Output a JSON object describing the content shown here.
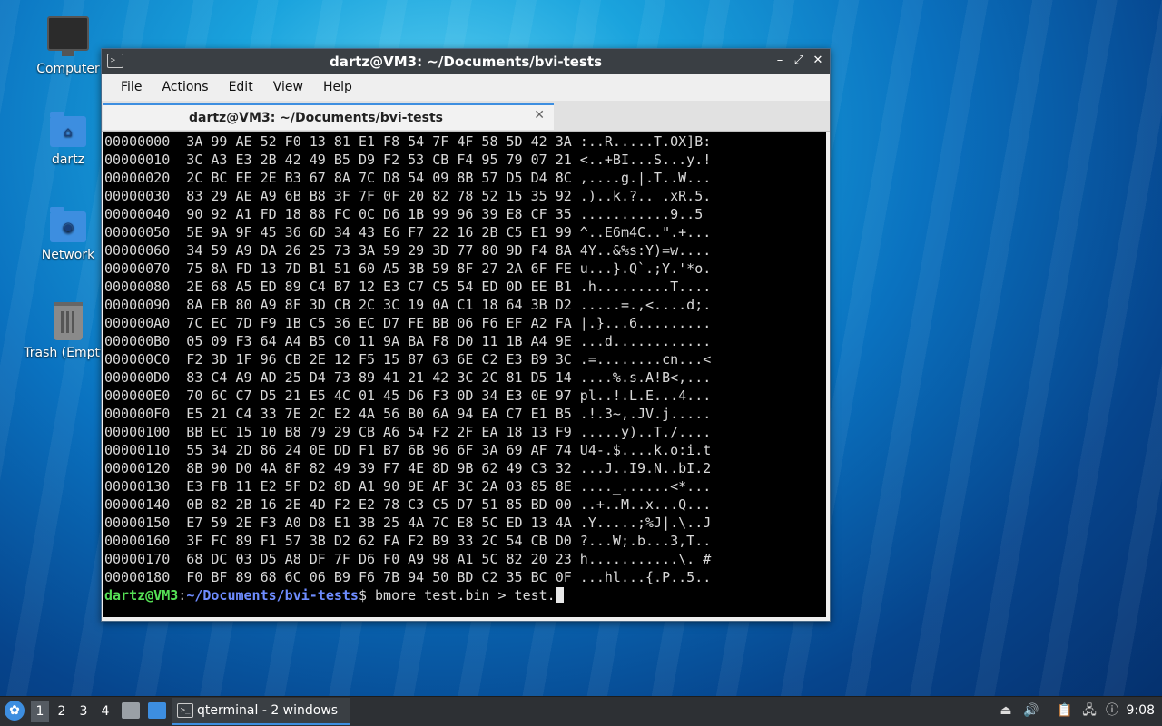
{
  "desktop": {
    "icons": [
      {
        "label": "Computer",
        "icon": "computer-icon"
      },
      {
        "label": "dartz",
        "icon": "home-folder-icon"
      },
      {
        "label": "Network",
        "icon": "network-folder-icon"
      },
      {
        "label": "Trash (Empty)",
        "icon": "trash-icon"
      }
    ]
  },
  "window": {
    "title": "dartz@VM3: ~/Documents/bvi-tests",
    "controls": {
      "minimize": "–",
      "maximize": "⤢",
      "close": "✕"
    },
    "menu": [
      "File",
      "Actions",
      "Edit",
      "View",
      "Help"
    ],
    "tab": {
      "label": "dartz@VM3: ~/Documents/bvi-tests",
      "close": "✕"
    },
    "terminal": {
      "lines": [
        "00000000  3A 99 AE 52 F0 13 81 E1 F8 54 7F 4F 58 5D 42 3A :..R.....T.OX]B:",
        "00000010  3C A3 E3 2B 42 49 B5 D9 F2 53 CB F4 95 79 07 21 <..+BI...S...y.!",
        "00000020  2C BC EE 2E B3 67 8A 7C D8 54 09 8B 57 D5 D4 8C ,....g.|.T..W...",
        "00000030  83 29 AE A9 6B B8 3F 7F 0F 20 82 78 52 15 35 92 .)..k.?.. .xR.5.",
        "00000040  90 92 A1 FD 18 88 FC 0C D6 1B 99 96 39 E8 CF 35 ...........9..5",
        "00000050  5E 9A 9F 45 36 6D 34 43 E6 F7 22 16 2B C5 E1 99 ^..E6m4C..\".+...",
        "00000060  34 59 A9 DA 26 25 73 3A 59 29 3D 77 80 9D F4 8A 4Y..&%s:Y)=w....",
        "00000070  75 8A FD 13 7D B1 51 60 A5 3B 59 8F 27 2A 6F FE u...}.Q`.;Y.'*o.",
        "00000080  2E 68 A5 ED 89 C4 B7 12 E3 C7 C5 54 ED 0D EE B1 .h.........T....",
        "00000090  8A EB 80 A9 8F 3D CB 2C 3C 19 0A C1 18 64 3B D2 .....=.,<....d;.",
        "000000A0  7C EC 7D F9 1B C5 36 EC D7 FE BB 06 F6 EF A2 FA |.}...6.........",
        "000000B0  05 09 F3 64 A4 B5 C0 11 9A BA F8 D0 11 1B A4 9E ...d............",
        "000000C0  F2 3D 1F 96 CB 2E 12 F5 15 87 63 6E C2 E3 B9 3C .=........cn...<",
        "000000D0  83 C4 A9 AD 25 D4 73 89 41 21 42 3C 2C 81 D5 14 ....%.s.A!B<,...",
        "000000E0  70 6C C7 D5 21 E5 4C 01 45 D6 F3 0D 34 E3 0E 97 pl..!.L.E...4...",
        "000000F0  E5 21 C4 33 7E 2C E2 4A 56 B0 6A 94 EA C7 E1 B5 .!.3~,.JV.j.....",
        "00000100  BB EC 15 10 B8 79 29 CB A6 54 F2 2F EA 18 13 F9 .....y)..T./....",
        "00000110  55 34 2D 86 24 0E DD F1 B7 6B 96 6F 3A 69 AF 74 U4-.$....k.o:i.t",
        "00000120  8B 90 D0 4A 8F 82 49 39 F7 4E 8D 9B 62 49 C3 32 ...J..I9.N..bI.2",
        "00000130  E3 FB 11 E2 5F D2 8D A1 90 9E AF 3C 2A 03 85 8E ...._......<*...",
        "00000140  0B 82 2B 16 2E 4D F2 E2 78 C3 C5 D7 51 85 BD 00 ..+..M..x...Q...",
        "00000150  E7 59 2E F3 A0 D8 E1 3B 25 4A 7C E8 5C ED 13 4A .Y.....;%J|.\\..J",
        "00000160  3F FC 89 F1 57 3B D2 62 FA F2 B9 33 2C 54 CB D0 ?...W;.b...3,T..",
        "00000170  68 DC 03 D5 A8 DF 7F D6 F0 A9 98 A1 5C 82 20 23 h...........\\. #",
        "00000180  F0 BF 89 68 6C 06 B9 F6 7B 94 50 BD C2 35 BC 0F ...hl...{.P..5.."
      ],
      "prompt": {
        "user": "dartz@VM3",
        "sep": ":",
        "path": "~/Documents/bvi-tests",
        "symbol": "$ ",
        "command": "bmore test.bin > test."
      }
    }
  },
  "taskbar": {
    "workspaces": [
      "1",
      "2",
      "3",
      "4"
    ],
    "active_workspace": "1",
    "task_label": "qterminal - 2 windows",
    "clock": "9:08"
  }
}
